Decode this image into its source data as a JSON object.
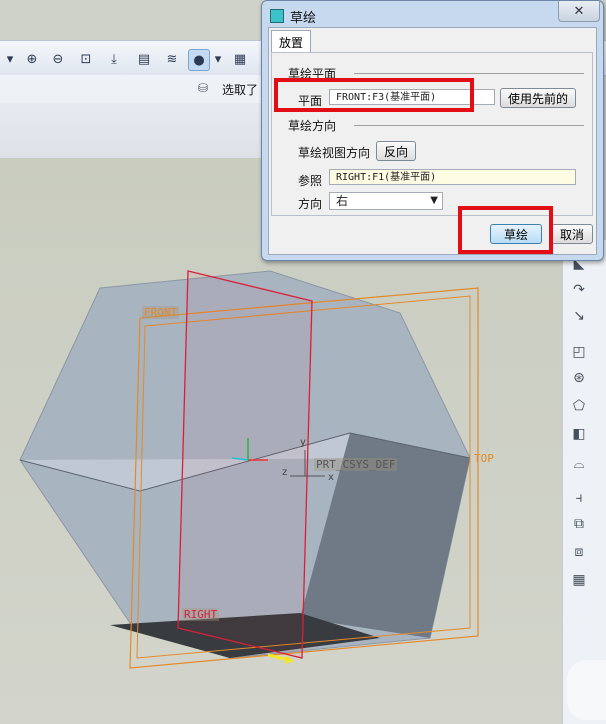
{
  "toolbar": {
    "icons": [
      "zoom-in-icon",
      "zoom-out-icon",
      "zoom-fit-icon",
      "reorient-icon",
      "named-view-icon",
      "layers-icon",
      "display-style-icon",
      "dropdown-icon",
      "saved-views-icon"
    ],
    "select_label": "选取了"
  },
  "dialog": {
    "title": "草绘",
    "close_glyph": "✕",
    "tab_label": "放置",
    "sketch_plane_section": "草绘平面",
    "plane_label": "平面",
    "plane_value": "FRONT:F3(基准平面)",
    "use_previous_button": "使用先前的",
    "orientation_section": "草绘方向",
    "view_direction_label": "草绘视图方向",
    "flip_button": "反向",
    "reference_label": "参照",
    "reference_value": "RIGHT:F1(基准平面)",
    "direction_label": "方向",
    "direction_value": "右",
    "sketch_button": "草绘",
    "cancel_button": "取消"
  },
  "viewport": {
    "plane_labels": {
      "front": "FRONT",
      "right": "RIGHT",
      "top": "TOP"
    },
    "csys_label": "PRT_CSYS_DEF",
    "axis_labels": {
      "y": "y",
      "z": "z",
      "x": "x"
    }
  },
  "colors": {
    "highlight_red": "#e30d16",
    "datum_orange": "#e38a2a",
    "selected_plane_red": "#d8203a",
    "solid_body": "#a9b4c1"
  }
}
